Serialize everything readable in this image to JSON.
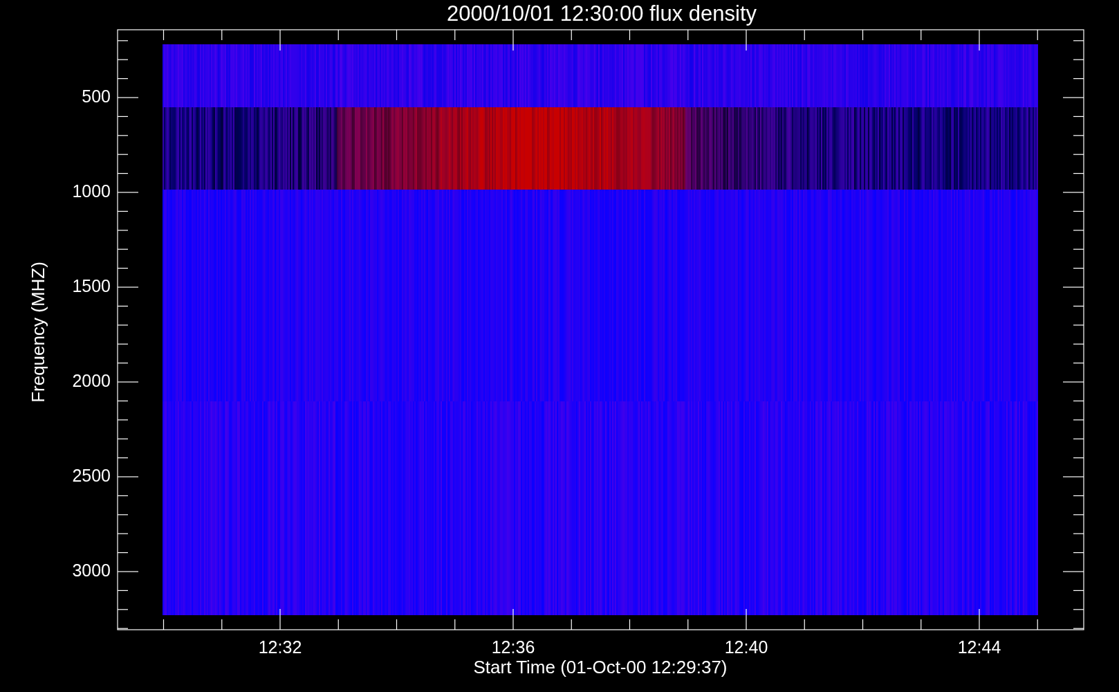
{
  "title": "2000/10/01 12:30:00 flux density",
  "y_axis": {
    "label": "Frequency (MHZ)",
    "ticks": [
      "500",
      "1000",
      "1500",
      "2000",
      "2500",
      "3000"
    ]
  },
  "x_axis": {
    "label": "Start Time (01-Oct-00 12:29:37)",
    "ticks": [
      "12:32",
      "12:36",
      "12:40",
      "12:44"
    ]
  }
}
